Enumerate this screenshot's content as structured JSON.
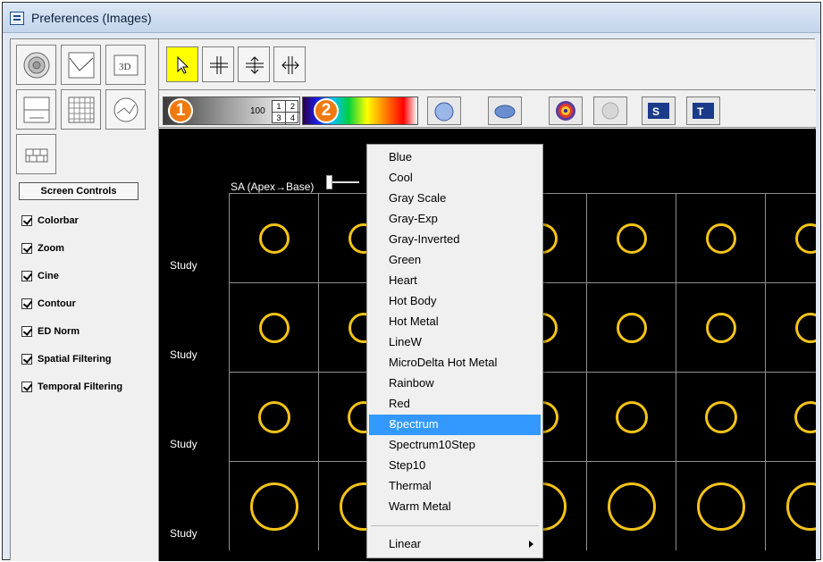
{
  "window": {
    "title": "Preferences (Images)"
  },
  "left_panel": {
    "screen_controls_label": "Screen Controls",
    "checkboxes": [
      {
        "label": "Colorbar",
        "checked": true
      },
      {
        "label": "Zoom",
        "checked": true
      },
      {
        "label": "Cine",
        "checked": true
      },
      {
        "label": "Contour",
        "checked": true
      },
      {
        "label": "ED Norm",
        "checked": true
      },
      {
        "label": "Spatial Filtering",
        "checked": true
      },
      {
        "label": "Temporal Filtering",
        "checked": true
      }
    ]
  },
  "toolbar": {
    "threed_label": "3D",
    "gray_max_value": "100",
    "layout_numbers": [
      "1",
      "2",
      "3",
      "4"
    ],
    "badges": [
      "1",
      "2"
    ]
  },
  "viewport": {
    "slider_label": "SA (Apex→Base)",
    "row_labels": [
      "Study",
      "Study",
      "Study",
      "Study"
    ]
  },
  "menu": {
    "items": [
      "Blue",
      "Cool",
      "Gray Scale",
      "Gray-Exp",
      "Gray-Inverted",
      "Green",
      "Heart",
      "Hot Body",
      "Hot Metal",
      "LineW",
      "MicroDelta Hot Metal",
      "Rainbow",
      "Red",
      "Spectrum",
      "Spectrum10Step",
      "Step10",
      "Thermal",
      "Warm Metal"
    ],
    "selected": "Spectrum",
    "scale_item": "Linear"
  },
  "colors": {
    "accent_yellow": "#ffff00",
    "badge_orange": "#f07a0f",
    "ring_yellow": "#f3c319",
    "selection_blue": "#3399ff"
  }
}
